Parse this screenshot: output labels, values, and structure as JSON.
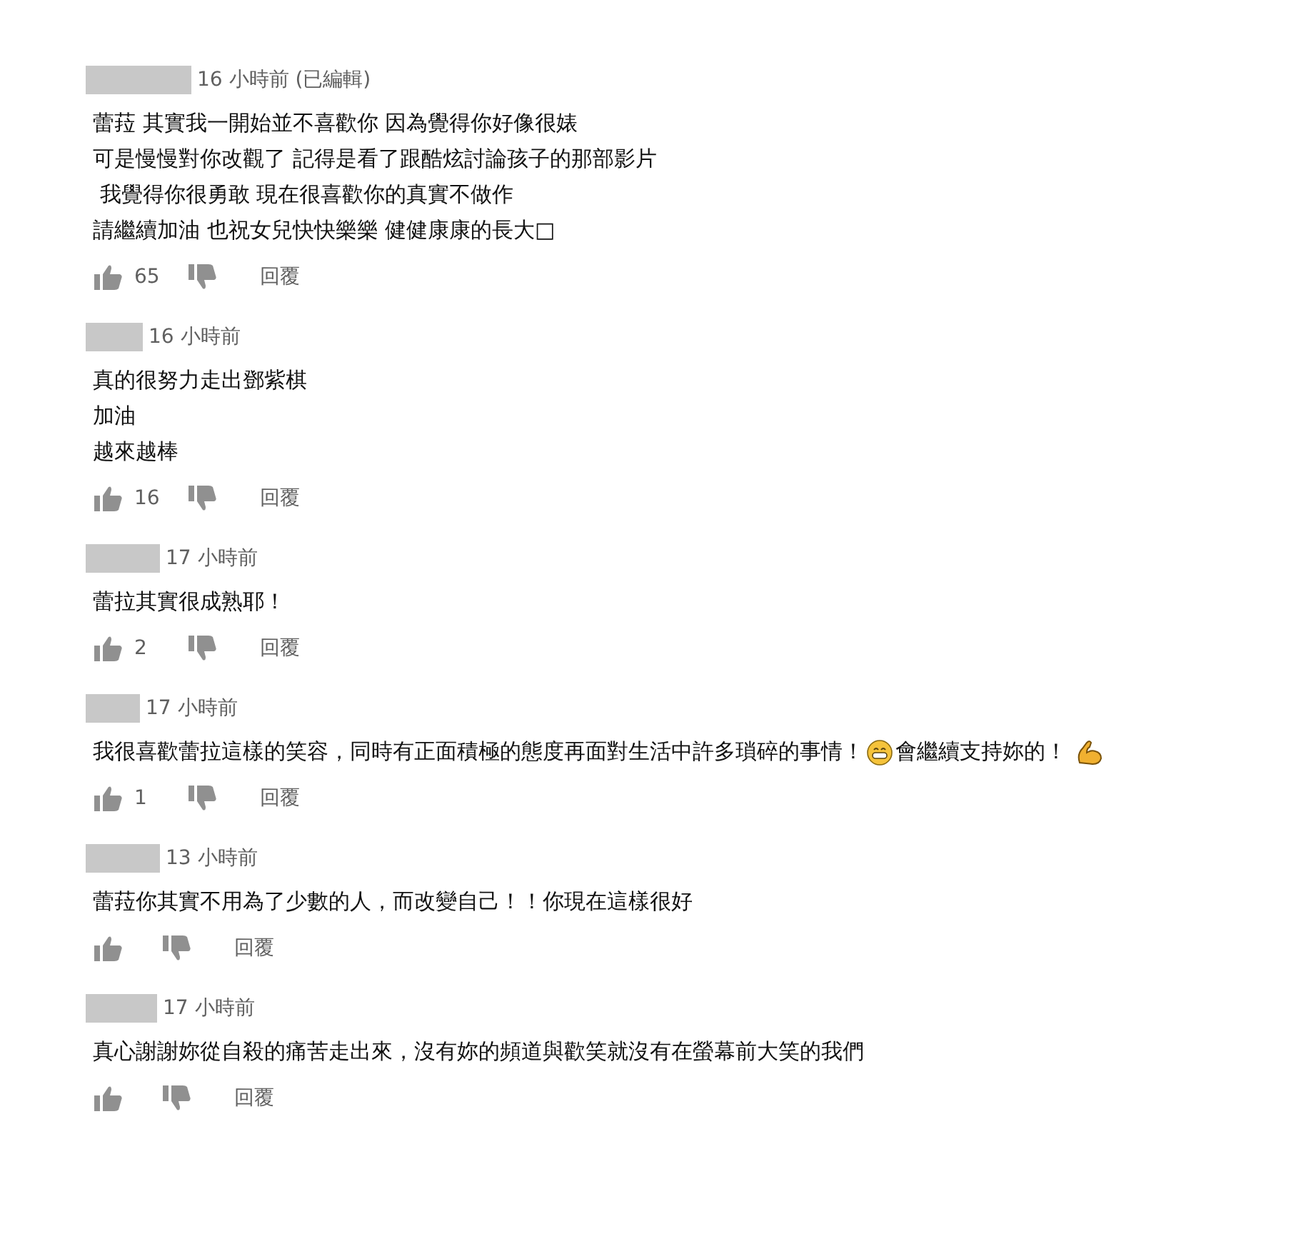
{
  "comments": [
    {
      "time": "16 小時前 (已編輯)",
      "lines": [
        [
          {
            "kind": "text",
            "text": "蕾菈 其實我一開始並不喜歡你 因為覺得你好像很婊"
          }
        ],
        [
          {
            "kind": "text",
            "text": "可是慢慢對你改觀了 記得是看了跟酷炫討論孩子的那部影片"
          }
        ],
        [
          {
            "kind": "text",
            "text": " 我覺得你很勇敢 現在很喜歡你的真實不做作"
          }
        ],
        [
          {
            "kind": "text",
            "text": "請繼續加油 也祝女兒快快樂樂 健健康康的長大□"
          }
        ]
      ],
      "likes": "65",
      "reply": "回覆"
    },
    {
      "time": "16 小時前",
      "lines": [
        [
          {
            "kind": "text",
            "text": "真的很努力走出鄧紫棋"
          }
        ],
        [
          {
            "kind": "text",
            "text": "加油"
          }
        ],
        [
          {
            "kind": "text",
            "text": "越來越棒"
          }
        ]
      ],
      "likes": "16",
      "reply": "回覆"
    },
    {
      "time": "17 小時前",
      "lines": [
        [
          {
            "kind": "text",
            "text": "蕾拉其實很成熟耶！"
          }
        ]
      ],
      "likes": "2",
      "reply": "回覆"
    },
    {
      "time": "17 小時前",
      "lines": [
        [
          {
            "kind": "text",
            "text": "我很喜歡蕾拉這樣的笑容，同時有正面積極的態度再面對生活中許多瑣碎的事情！"
          },
          {
            "kind": "grin"
          },
          {
            "kind": "text",
            "text": "會繼續支持妳的！"
          },
          {
            "kind": "flex"
          }
        ]
      ],
      "likes": "1",
      "reply": "回覆"
    },
    {
      "time": "13 小時前",
      "lines": [
        [
          {
            "kind": "text",
            "text": "蕾菈你其實不用為了少數的人，而改變自己！！你現在這樣很好"
          }
        ]
      ],
      "reply": "回覆"
    },
    {
      "time": "17 小時前",
      "lines": [
        [
          {
            "kind": "text",
            "text": "真心謝謝妳從自殺的痛苦走出來，沒有妳的頻道與歡笑就沒有在螢幕前大笑的我們"
          }
        ]
      ],
      "reply": "回覆"
    }
  ]
}
